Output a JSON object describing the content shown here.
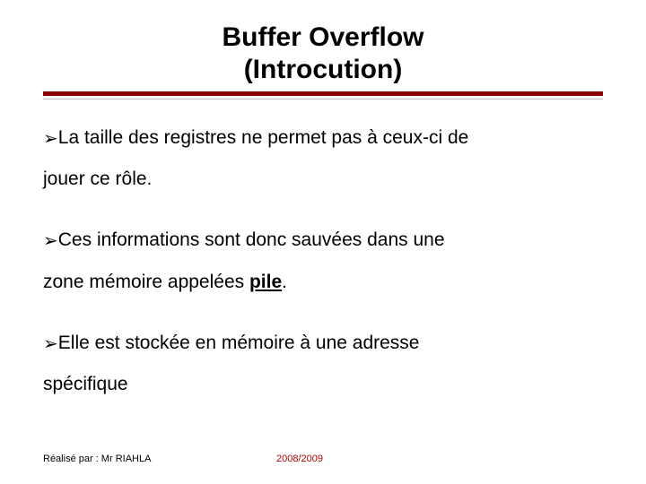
{
  "title_line1": "Buffer Overflow",
  "title_line2": "(Introcution)",
  "bullets": {
    "b1_a": "La taille des registres ne permet pas à ceux-ci de",
    "b1_b": "jouer ce rôle.",
    "b2_a": "Ces informations sont donc sauvées dans une",
    "b2_b_pre": "zone mémoire appelées ",
    "b2_b_pile": "pile",
    "b2_b_post": ".",
    "b3_a": "Elle est stockée en mémoire à une adresse",
    "b3_b": "spécifique"
  },
  "bullet_glyph": "➢",
  "footer": {
    "left": "Réalisé par :  Mr RIAHLA",
    "center": "2008/2009"
  }
}
